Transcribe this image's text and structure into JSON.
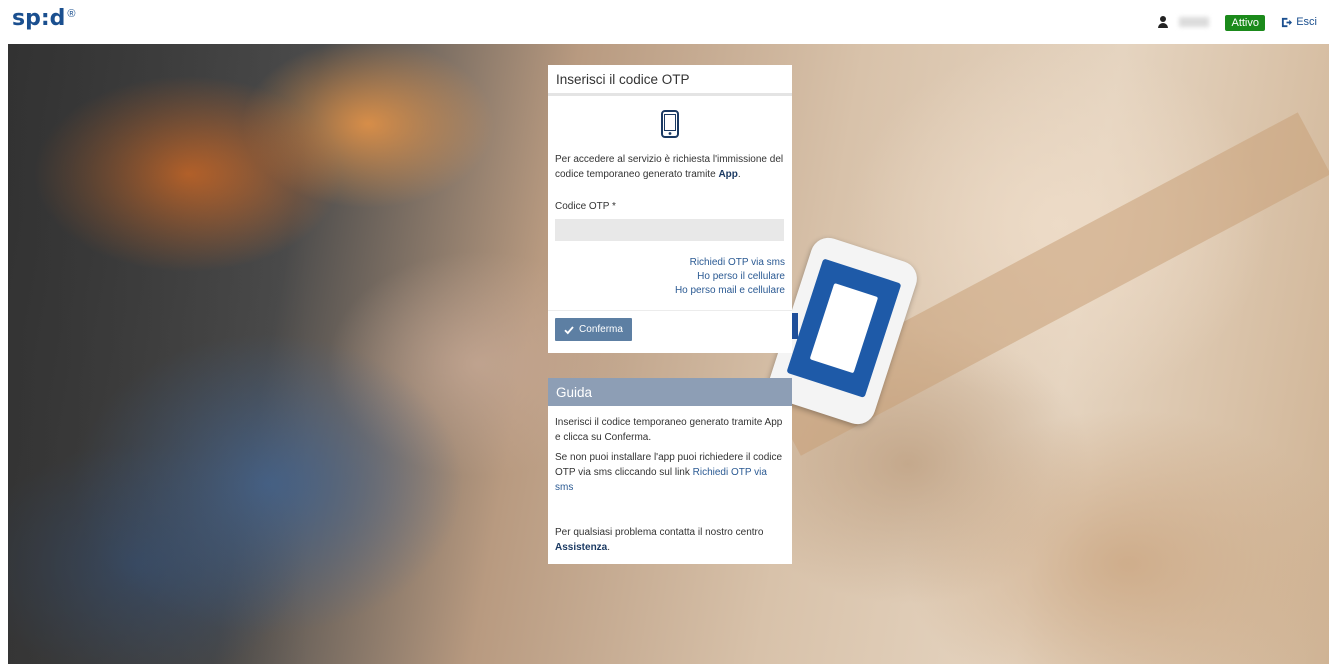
{
  "header": {
    "logo_text": "sp:d",
    "logo_mark": "®",
    "user_name": "",
    "status_badge": "Attivo",
    "logout_label": "Esci",
    "status_color": "#1b8a1b"
  },
  "otp_panel": {
    "title": "Inserisci il codice OTP",
    "icon": "mobile-phone-icon",
    "intro_text": "Per accedere al servizio è richiesta l'immissione del codice temporaneo generato tramite ",
    "intro_bold": "App",
    "intro_end": ".",
    "field_label": "Codice OTP *",
    "field_value": "",
    "links": [
      "Richiedi OTP via sms",
      "Ho perso il cellulare",
      "Ho perso mail e cellulare"
    ],
    "confirm_label": "Conferma",
    "accent_color": "#5d7fa3"
  },
  "guide_panel": {
    "title": "Guida",
    "para1": "Inserisci il codice temporaneo generato tramite App e clicca su Conferma.",
    "para2_text": "Se non puoi installare l'app puoi richiedere il codice OTP via sms cliccando sul link ",
    "para2_link": "Richiedi OTP via sms",
    "para3_text": "Per qualsiasi problema contatta il nostro centro ",
    "para3_link": "Assistenza",
    "para3_end": ".",
    "header_color": "#8d9eb5"
  }
}
